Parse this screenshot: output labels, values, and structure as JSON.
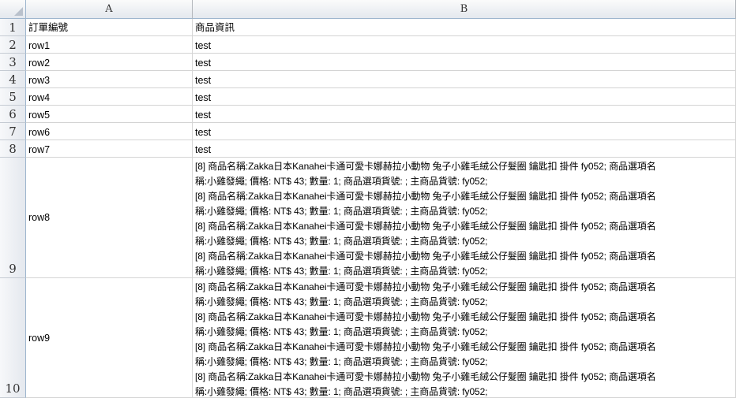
{
  "columns": [
    "A",
    "B"
  ],
  "row_numbers": [
    "1",
    "2",
    "3",
    "4",
    "5",
    "6",
    "7",
    "8",
    "9",
    "10"
  ],
  "header_row": {
    "a": "訂單編號",
    "b": "商品資訊"
  },
  "rows": [
    {
      "a": "row1",
      "b": "test"
    },
    {
      "a": "row2",
      "b": "test"
    },
    {
      "a": "row3",
      "b": "test"
    },
    {
      "a": "row4",
      "b": "test"
    },
    {
      "a": "row5",
      "b": "test"
    },
    {
      "a": "row6",
      "b": "test"
    },
    {
      "a": "row7",
      "b": "test"
    }
  ],
  "tall_rows": [
    {
      "a": "row8",
      "lines": [
        "[8] 商品名稱:Zakka日本Kanahei卡通可愛卡娜赫拉小動物 兔子小雞毛絨公仔髮圈 鑰匙扣 掛件 fy052; 商品選項名",
        "稱:小雞發繩; 價格: NT$ 43; 數量: 1; 商品選項貨號: ; 主商品貨號: fy052;",
        "[8] 商品名稱:Zakka日本Kanahei卡通可愛卡娜赫拉小動物 兔子小雞毛絨公仔髮圈 鑰匙扣 掛件 fy052; 商品選項名",
        "稱:小雞發繩; 價格: NT$ 43; 數量: 1; 商品選項貨號: ; 主商品貨號: fy052;",
        "[8] 商品名稱:Zakka日本Kanahei卡通可愛卡娜赫拉小動物 兔子小雞毛絨公仔髮圈 鑰匙扣 掛件 fy052; 商品選項名",
        "稱:小雞發繩; 價格: NT$ 43; 數量: 1; 商品選項貨號: ; 主商品貨號: fy052;",
        "[8] 商品名稱:Zakka日本Kanahei卡通可愛卡娜赫拉小動物 兔子小雞毛絨公仔髮圈 鑰匙扣 掛件 fy052; 商品選項名",
        "稱:小雞發繩; 價格: NT$ 43; 數量: 1; 商品選項貨號: ; 主商品貨號: fy052;"
      ]
    },
    {
      "a": "row9",
      "lines": [
        "[8] 商品名稱:Zakka日本Kanahei卡通可愛卡娜赫拉小動物 兔子小雞毛絨公仔髮圈 鑰匙扣 掛件 fy052; 商品選項名",
        "稱:小雞發繩; 價格: NT$ 43; 數量: 1; 商品選項貨號: ; 主商品貨號: fy052;",
        "[8] 商品名稱:Zakka日本Kanahei卡通可愛卡娜赫拉小動物 兔子小雞毛絨公仔髮圈 鑰匙扣 掛件 fy052; 商品選項名",
        "稱:小雞發繩; 價格: NT$ 43; 數量: 1; 商品選項貨號: ; 主商品貨號: fy052;",
        "[8] 商品名稱:Zakka日本Kanahei卡通可愛卡娜赫拉小動物 兔子小雞毛絨公仔髮圈 鑰匙扣 掛件 fy052; 商品選項名",
        "稱:小雞發繩; 價格: NT$ 43; 數量: 1; 商品選項貨號: ; 主商品貨號: fy052;",
        "[8] 商品名稱:Zakka日本Kanahei卡通可愛卡娜赫拉小動物 兔子小雞毛絨公仔髮圈 鑰匙扣 掛件 fy052; 商品選項名",
        "稱:小雞發繩; 價格: NT$ 43; 數量: 1; 商品選項貨號: ; 主商品貨號: fy052;"
      ]
    }
  ]
}
